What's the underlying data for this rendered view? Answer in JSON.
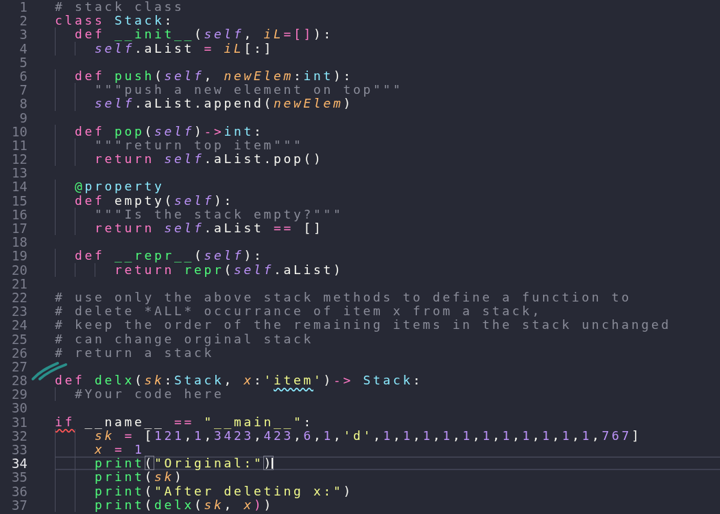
{
  "lines": [
    {
      "number": "1",
      "current": false,
      "tokens": [
        {
          "kind": "comment",
          "text": "# stack class"
        }
      ]
    },
    {
      "number": "2",
      "current": false,
      "tokens": [
        {
          "kind": "keyword",
          "text": "class "
        },
        {
          "kind": "class",
          "text": "Stack"
        },
        {
          "kind": "plain",
          "text": ":"
        }
      ]
    },
    {
      "number": "3",
      "current": false,
      "tokens": [
        {
          "kind": "keyword",
          "text": "  def "
        },
        {
          "kind": "function",
          "text": "__init__"
        },
        {
          "kind": "plain",
          "text": "("
        },
        {
          "kind": "self",
          "text": "self"
        },
        {
          "kind": "plain",
          "text": ", "
        },
        {
          "kind": "param",
          "text": "iL"
        },
        {
          "kind": "operator",
          "text": "=[]"
        },
        {
          "kind": "plain",
          "text": "):"
        }
      ]
    },
    {
      "number": "4",
      "current": false,
      "tokens": [
        {
          "kind": "self",
          "text": "    self"
        },
        {
          "kind": "plain",
          "text": ".aList "
        },
        {
          "kind": "operator",
          "text": "= "
        },
        {
          "kind": "param",
          "text": "iL"
        },
        {
          "kind": "plain",
          "text": "[:]"
        }
      ]
    },
    {
      "number": "5",
      "current": false
    },
    {
      "number": "6",
      "current": false,
      "tokens": [
        {
          "kind": "keyword",
          "text": "  def "
        },
        {
          "kind": "function",
          "text": "push"
        },
        {
          "kind": "plain",
          "text": "("
        },
        {
          "kind": "self",
          "text": "self"
        },
        {
          "kind": "plain",
          "text": ", "
        },
        {
          "kind": "param",
          "text": "newElem"
        },
        {
          "kind": "plain",
          "text": ":"
        },
        {
          "kind": "class",
          "text": "int"
        },
        {
          "kind": "plain",
          "text": "):"
        }
      ]
    },
    {
      "number": "7",
      "current": false,
      "tokens": [
        {
          "kind": "comment",
          "text": "    \"\"\"push a new element on top\"\"\""
        }
      ]
    },
    {
      "number": "8",
      "current": false,
      "tokens": [
        {
          "kind": "self",
          "text": "    self"
        },
        {
          "kind": "plain",
          "text": ".aList.append("
        },
        {
          "kind": "param",
          "text": "newElem"
        },
        {
          "kind": "plain",
          "text": ")"
        }
      ]
    },
    {
      "number": "9",
      "current": false
    },
    {
      "number": "10",
      "current": false,
      "tokens": [
        {
          "kind": "keyword",
          "text": "  def "
        },
        {
          "kind": "function",
          "text": "pop"
        },
        {
          "kind": "plain",
          "text": "("
        },
        {
          "kind": "self",
          "text": "self"
        },
        {
          "kind": "plain",
          "text": ")"
        },
        {
          "kind": "operator",
          "text": "->"
        },
        {
          "kind": "class",
          "text": "int"
        },
        {
          "kind": "plain",
          "text": ":"
        }
      ]
    },
    {
      "number": "11",
      "current": false,
      "tokens": [
        {
          "kind": "comment",
          "text": "    \"\"\"return top item\"\"\""
        }
      ]
    },
    {
      "number": "12",
      "current": false,
      "tokens": [
        {
          "kind": "keyword",
          "text": "    return "
        },
        {
          "kind": "self",
          "text": "self"
        },
        {
          "kind": "plain",
          "text": ".aList.pop()"
        }
      ]
    },
    {
      "number": "13",
      "current": false
    },
    {
      "number": "14",
      "current": false,
      "tokens": [
        {
          "kind": "decorator",
          "text": "  @"
        },
        {
          "kind": "class",
          "text": "property"
        }
      ]
    },
    {
      "number": "15",
      "current": false,
      "tokens": [
        {
          "kind": "keyword",
          "text": "  def "
        },
        {
          "kind": "plain",
          "text": "empty("
        },
        {
          "kind": "self",
          "text": "self"
        },
        {
          "kind": "plain",
          "text": "):"
        }
      ]
    },
    {
      "number": "16",
      "current": false,
      "tokens": [
        {
          "kind": "comment",
          "text": "    \"\"\"Is the stack empty?\"\"\""
        }
      ]
    },
    {
      "number": "17",
      "current": false,
      "tokens": [
        {
          "kind": "keyword",
          "text": "    return "
        },
        {
          "kind": "self",
          "text": "self"
        },
        {
          "kind": "plain",
          "text": ".aList "
        },
        {
          "kind": "operator",
          "text": "== "
        },
        {
          "kind": "plain",
          "text": "[]"
        }
      ]
    },
    {
      "number": "18",
      "current": false
    },
    {
      "number": "19",
      "current": false,
      "tokens": [
        {
          "kind": "keyword",
          "text": "  def "
        },
        {
          "kind": "function",
          "text": "__repr__"
        },
        {
          "kind": "plain",
          "text": "("
        },
        {
          "kind": "self",
          "text": "self"
        },
        {
          "kind": "plain",
          "text": "):"
        }
      ]
    },
    {
      "number": "20",
      "current": false,
      "tokens": [
        {
          "kind": "keyword",
          "text": "      return "
        },
        {
          "kind": "function",
          "text": "repr"
        },
        {
          "kind": "plain",
          "text": "("
        },
        {
          "kind": "self",
          "text": "self"
        },
        {
          "kind": "plain",
          "text": ".aList)"
        }
      ]
    },
    {
      "number": "21",
      "current": false
    },
    {
      "number": "22",
      "current": false,
      "tokens": [
        {
          "kind": "comment",
          "text": "# use only the above stack methods to define a function to"
        }
      ]
    },
    {
      "number": "23",
      "current": false,
      "tokens": [
        {
          "kind": "comment",
          "text": "# delete *ALL* occurrance of item x from a stack,"
        }
      ]
    },
    {
      "number": "24",
      "current": false,
      "tokens": [
        {
          "kind": "comment",
          "text": "# keep the order of the remaining items in the stack unchanged"
        }
      ]
    },
    {
      "number": "25",
      "current": false,
      "tokens": [
        {
          "kind": "comment",
          "text": "# can change orginal stack"
        }
      ]
    },
    {
      "number": "26",
      "current": false,
      "tokens": [
        {
          "kind": "comment",
          "text": "# return a stack"
        }
      ]
    },
    {
      "number": "27",
      "current": false
    },
    {
      "number": "28",
      "current": false,
      "tokens": [
        {
          "kind": "keyword",
          "text": "def "
        },
        {
          "kind": "function",
          "text": "delx"
        },
        {
          "kind": "plain",
          "text": "("
        },
        {
          "kind": "param",
          "text": "sk"
        },
        {
          "kind": "plain",
          "text": ":"
        },
        {
          "kind": "class",
          "text": "Stack"
        },
        {
          "kind": "plain",
          "text": ", "
        },
        {
          "kind": "param",
          "text": "x"
        },
        {
          "kind": "plain",
          "text": ":"
        },
        {
          "kind": "string",
          "text": "'"
        },
        {
          "kind": "string",
          "text": "item",
          "warning": true
        },
        {
          "kind": "string",
          "text": "'"
        },
        {
          "kind": "plain",
          "text": ")"
        },
        {
          "kind": "operator",
          "text": "-> "
        },
        {
          "kind": "class",
          "text": "Stack"
        },
        {
          "kind": "plain",
          "text": ":"
        }
      ]
    },
    {
      "number": "29",
      "current": false,
      "tokens": [
        {
          "kind": "comment",
          "text": "  #Your code here"
        }
      ]
    },
    {
      "number": "30",
      "current": false
    },
    {
      "number": "31",
      "current": false,
      "tokens": [
        {
          "kind": "keyword",
          "text": "if",
          "error": true
        },
        {
          "kind": "plain",
          "text": " __name__ "
        },
        {
          "kind": "operator",
          "text": "== "
        },
        {
          "kind": "string",
          "text": "\"__main__\""
        },
        {
          "kind": "plain",
          "text": ":"
        }
      ]
    },
    {
      "number": "32",
      "current": false,
      "tokens": [
        {
          "kind": "param",
          "text": "    sk "
        },
        {
          "kind": "operator",
          "text": "= "
        },
        {
          "kind": "plain",
          "text": "["
        },
        {
          "kind": "number",
          "text": "121"
        },
        {
          "kind": "plain",
          "text": ","
        },
        {
          "kind": "number",
          "text": "1"
        },
        {
          "kind": "plain",
          "text": ","
        },
        {
          "kind": "number",
          "text": "3423"
        },
        {
          "kind": "plain",
          "text": ","
        },
        {
          "kind": "number",
          "text": "423"
        },
        {
          "kind": "plain",
          "text": ","
        },
        {
          "kind": "number",
          "text": "6"
        },
        {
          "kind": "plain",
          "text": ","
        },
        {
          "kind": "number",
          "text": "1"
        },
        {
          "kind": "plain",
          "text": ","
        },
        {
          "kind": "string",
          "text": "'d'"
        },
        {
          "kind": "plain",
          "text": ","
        },
        {
          "kind": "number",
          "text": "1"
        },
        {
          "kind": "plain",
          "text": ","
        },
        {
          "kind": "number",
          "text": "1"
        },
        {
          "kind": "plain",
          "text": ","
        },
        {
          "kind": "number",
          "text": "1"
        },
        {
          "kind": "plain",
          "text": ","
        },
        {
          "kind": "number",
          "text": "1"
        },
        {
          "kind": "plain",
          "text": ","
        },
        {
          "kind": "number",
          "text": "1"
        },
        {
          "kind": "plain",
          "text": ","
        },
        {
          "kind": "number",
          "text": "1"
        },
        {
          "kind": "plain",
          "text": ","
        },
        {
          "kind": "number",
          "text": "1"
        },
        {
          "kind": "plain",
          "text": ","
        },
        {
          "kind": "number",
          "text": "1"
        },
        {
          "kind": "plain",
          "text": ","
        },
        {
          "kind": "number",
          "text": "1"
        },
        {
          "kind": "plain",
          "text": ","
        },
        {
          "kind": "number",
          "text": "1"
        },
        {
          "kind": "plain",
          "text": ","
        },
        {
          "kind": "number",
          "text": "1"
        },
        {
          "kind": "plain",
          "text": ","
        },
        {
          "kind": "number",
          "text": "767"
        },
        {
          "kind": "plain",
          "text": "]"
        }
      ]
    },
    {
      "number": "33",
      "current": false,
      "tokens": [
        {
          "kind": "param",
          "text": "    x "
        },
        {
          "kind": "operator",
          "text": "= "
        },
        {
          "kind": "number",
          "text": "1"
        }
      ]
    },
    {
      "number": "34",
      "current": true,
      "tokens": [
        {
          "kind": "function",
          "text": "    print"
        },
        {
          "kind": "plain",
          "text": "(",
          "matched": true
        },
        {
          "kind": "string",
          "text": "\"Original:\""
        },
        {
          "kind": "plain",
          "text": ")",
          "matched": true,
          "caret_after": true
        }
      ]
    },
    {
      "number": "35",
      "current": false,
      "tokens": [
        {
          "kind": "function",
          "text": "    print"
        },
        {
          "kind": "plain",
          "text": "("
        },
        {
          "kind": "param",
          "text": "sk"
        },
        {
          "kind": "plain",
          "text": ")"
        }
      ]
    },
    {
      "number": "36",
      "current": false,
      "tokens": [
        {
          "kind": "function",
          "text": "    print"
        },
        {
          "kind": "plain",
          "text": "("
        },
        {
          "kind": "string",
          "text": "\"After deleting x:\""
        },
        {
          "kind": "plain",
          "text": ")"
        }
      ]
    },
    {
      "number": "37",
      "current": false,
      "tokens": [
        {
          "kind": "function",
          "text": "    print"
        },
        {
          "kind": "plain",
          "text": "("
        },
        {
          "kind": "function",
          "text": "delx"
        },
        {
          "kind": "plain",
          "text": "("
        },
        {
          "kind": "param",
          "text": "sk"
        },
        {
          "kind": "plain",
          "text": ", "
        },
        {
          "kind": "param",
          "text": "x"
        },
        {
          "kind": "operator",
          "text": ")"
        },
        {
          "kind": "plain",
          "text": ")"
        }
      ]
    }
  ]
}
